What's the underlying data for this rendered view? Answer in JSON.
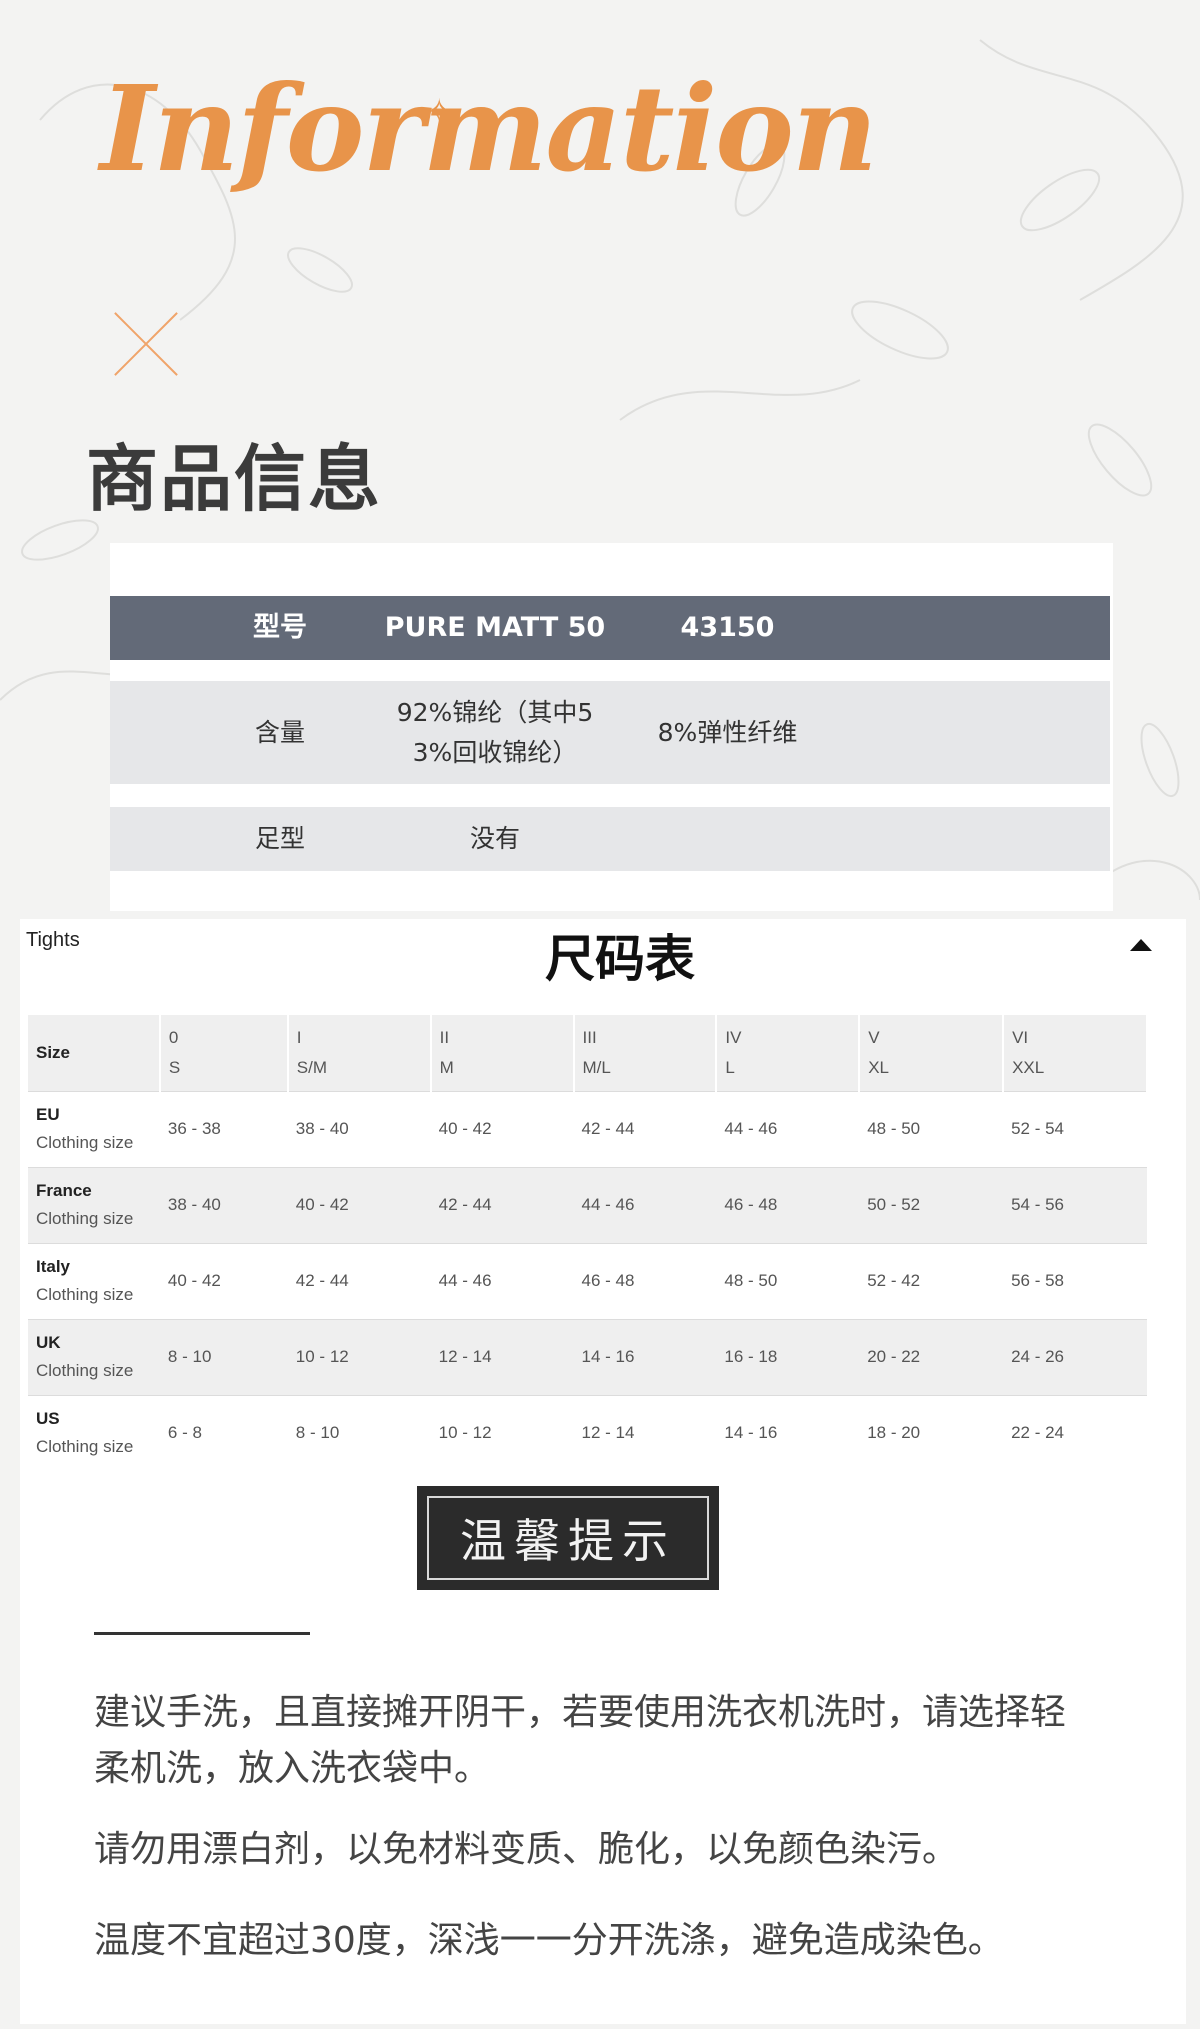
{
  "brand": {
    "title": "Information"
  },
  "product_info": {
    "heading": "商品信息",
    "rows": [
      {
        "label": "型号",
        "value1": "PURE MATT 50",
        "value2": "43150"
      },
      {
        "label": "含量",
        "value1": "92%锦纶（其中5 3%回收锦纶）",
        "value1_line1": "92%锦纶（其中5",
        "value1_line2": "3%回收锦纶）",
        "value2": "8%弹性纤维"
      },
      {
        "label": "足型",
        "value1": "没有",
        "value2": ""
      }
    ]
  },
  "size_chart": {
    "tab_label": "Tights",
    "title": "尺码表",
    "header": {
      "first": "Size",
      "columns": [
        {
          "roman": "0",
          "size": "S"
        },
        {
          "roman": "I",
          "size": "S/M"
        },
        {
          "roman": "II",
          "size": "M"
        },
        {
          "roman": "III",
          "size": "M/L"
        },
        {
          "roman": "IV",
          "size": "L"
        },
        {
          "roman": "V",
          "size": "XL"
        },
        {
          "roman": "VI",
          "size": "XXL"
        }
      ]
    },
    "rows": [
      {
        "region": "EU",
        "sub": "Clothing size",
        "values": [
          "36 - 38",
          "38 - 40",
          "40 - 42",
          "42 - 44",
          "44 - 46",
          "48 - 50",
          "52 - 54"
        ]
      },
      {
        "region": "France",
        "sub": "Clothing size",
        "values": [
          "38 - 40",
          "40 - 42",
          "42 - 44",
          "44 - 46",
          "46 - 48",
          "50 - 52",
          "54 - 56"
        ]
      },
      {
        "region": "Italy",
        "sub": "Clothing size",
        "values": [
          "40 - 42",
          "42 - 44",
          "44 - 46",
          "46 - 48",
          "48 - 50",
          "52 - 42",
          "56 - 58"
        ]
      },
      {
        "region": "UK",
        "sub": "Clothing size",
        "values": [
          "8 - 10",
          "10 - 12",
          "12 - 14",
          "14 - 16",
          "16 - 18",
          "20 - 22",
          "24 - 26"
        ]
      },
      {
        "region": "US",
        "sub": "Clothing size",
        "values": [
          "6 - 8",
          "8 - 10",
          "10 - 12",
          "12 - 14",
          "14 - 16",
          "18 - 20",
          "22 - 24"
        ]
      }
    ]
  },
  "notice": {
    "title": "温馨提示",
    "paragraphs": [
      "建议手洗，且直接摊开阴干，若要使用洗衣机洗时，请选择轻柔机洗，放入洗衣袋中。",
      "请勿用漂白剂，以免材料变质、脆化，以免颜色染污。",
      "温度不宜超过30度，深浅一一分开洗涤，避免造成染色。"
    ]
  },
  "colors": {
    "accent": "#e8944a",
    "table_header": "#636a78",
    "row_bg": "#e6e7e9",
    "background": "#f3f3f2"
  }
}
